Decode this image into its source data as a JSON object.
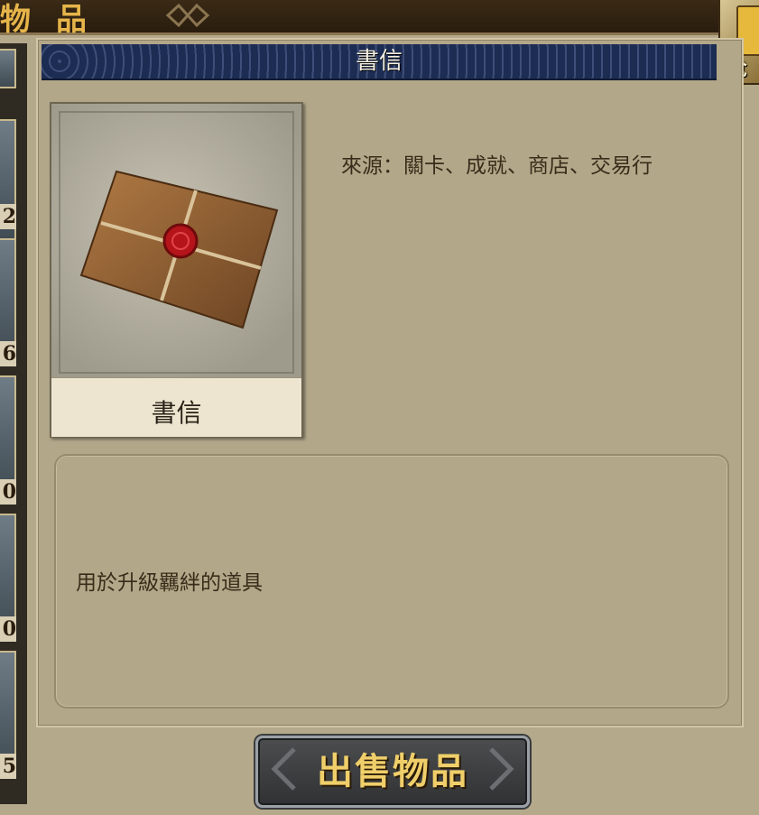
{
  "top_bar": {
    "title": "物品"
  },
  "corner_badge": {
    "label": "兌"
  },
  "left_list": {
    "counts": [
      "2",
      "6",
      "0",
      "0",
      "5"
    ]
  },
  "panel": {
    "header_title": "書信"
  },
  "item": {
    "name": "書信",
    "icon": "sealed-letter-icon",
    "source": "來源：關卡、成就、商店、交易行",
    "description": "用於升級羈絆的道具"
  },
  "actions": {
    "sell_label": "出售物品"
  },
  "colors": {
    "header_bg": "#1d2c52",
    "sell_text": "#f0cf6a",
    "title_gold": "#e6b54a"
  }
}
